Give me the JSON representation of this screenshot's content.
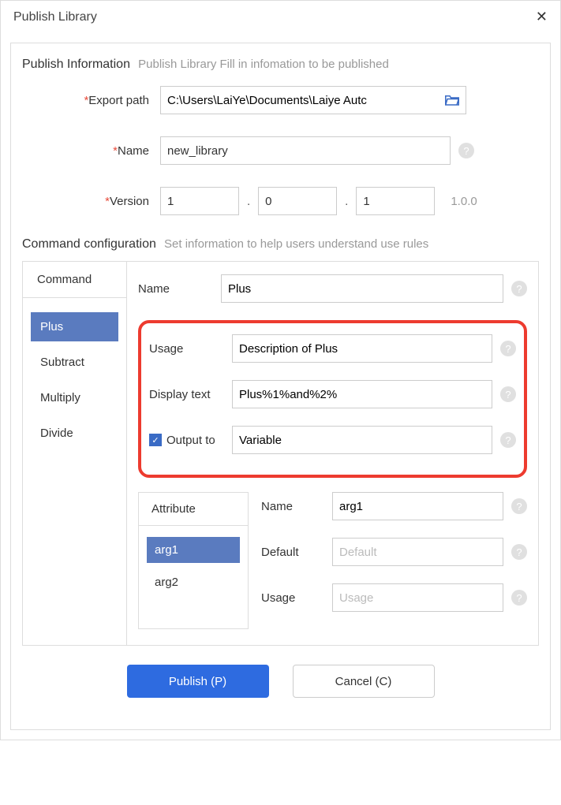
{
  "title": "Publish Library",
  "publishInfo": {
    "label": "Publish Information",
    "hint": "Publish Library Fill in infomation to be published",
    "exportPathLabel": "Export path",
    "exportPathValue": "C:\\Users\\LaiYe\\Documents\\Laiye Autc",
    "nameLabel": "Name",
    "nameValue": "new_library",
    "versionLabel": "Version",
    "v1": "1",
    "v2": "0",
    "v3": "1",
    "versionText": "1.0.0"
  },
  "cmdConfig": {
    "label": "Command configuration",
    "hint": "Set information to help users understand use rules"
  },
  "commands": {
    "header": "Command",
    "items": [
      "Plus",
      "Subtract",
      "Multiply",
      "Divide"
    ],
    "selected": "Plus"
  },
  "cmdDetail": {
    "nameLabel": "Name",
    "nameValue": "Plus",
    "usageLabel": "Usage",
    "usageValue": "Description of Plus",
    "displayTextLabel": "Display text",
    "displayTextValue": "Plus%1%and%2%",
    "outputToLabel": "Output to",
    "outputToValue": "Variable"
  },
  "attributes": {
    "header": "Attribute",
    "items": [
      "arg1",
      "arg2"
    ],
    "selected": "arg1",
    "nameLabel": "Name",
    "nameValue": "arg1",
    "defaultLabel": "Default",
    "defaultPlaceholder": "Default",
    "usageLabel": "Usage",
    "usagePlaceholder": "Usage"
  },
  "buttons": {
    "publish": "Publish (P)",
    "cancel": "Cancel (C)"
  },
  "star": "*",
  "help": "?",
  "check": "✓"
}
